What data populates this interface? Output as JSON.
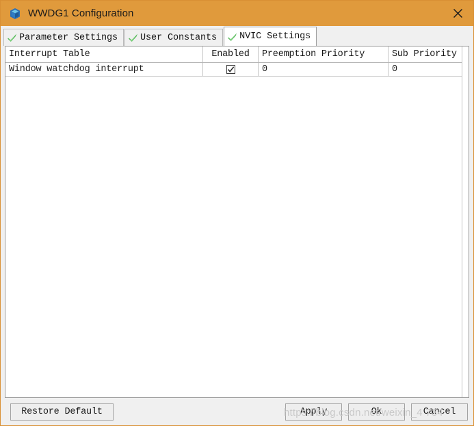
{
  "window": {
    "title": "WWDG1 Configuration",
    "icon": "cube-icon",
    "close_icon": "close-icon",
    "titlebar_color": "#e09a3c"
  },
  "tabs": [
    {
      "label": "Parameter Settings",
      "icon": "green-check-icon",
      "active": false
    },
    {
      "label": "User Constants",
      "icon": "green-check-icon",
      "active": false
    },
    {
      "label": "NVIC Settings",
      "icon": "green-check-icon",
      "active": true
    }
  ],
  "table": {
    "columns": [
      "Interrupt Table",
      "Enabled",
      "Preemption Priority",
      "Sub Priority"
    ],
    "rows": [
      {
        "name": "Window watchdog interrupt",
        "enabled": true,
        "preemption_priority": "0",
        "sub_priority": "0"
      }
    ]
  },
  "footer": {
    "restore_label": "Restore Default",
    "apply_label": "Apply",
    "ok_label": "Ok",
    "cancel_label": "Cancel"
  },
  "watermark": {
    "text": "https://blog.csdn.net/weixin_4      734"
  }
}
